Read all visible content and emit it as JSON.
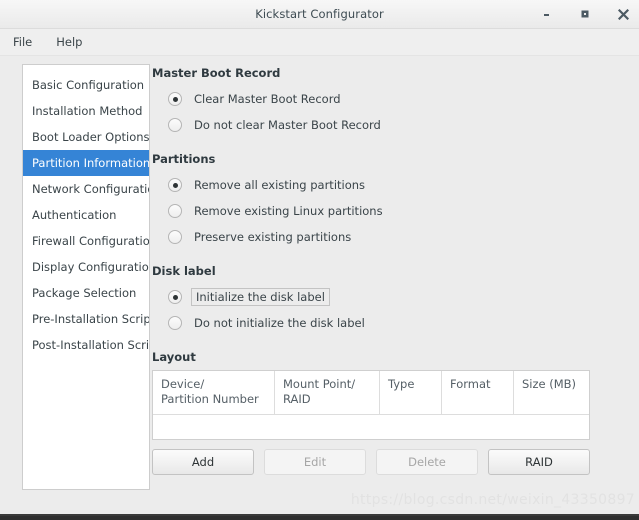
{
  "window": {
    "title": "Kickstart Configurator",
    "controls": [
      {
        "name": "minimize-button",
        "glyph": "minimize"
      },
      {
        "name": "maximize-button",
        "glyph": "maximize"
      },
      {
        "name": "close-button",
        "glyph": "close"
      }
    ]
  },
  "menubar": {
    "items": [
      {
        "label": "File"
      },
      {
        "label": "Help"
      }
    ]
  },
  "sidebar": {
    "items": [
      {
        "label": "Basic Configuration",
        "selected": false
      },
      {
        "label": "Installation Method",
        "selected": false
      },
      {
        "label": "Boot Loader Options",
        "selected": false
      },
      {
        "label": "Partition Information",
        "selected": true
      },
      {
        "label": "Network Configuration",
        "selected": false
      },
      {
        "label": "Authentication",
        "selected": false
      },
      {
        "label": "Firewall Configuration",
        "selected": false
      },
      {
        "label": "Display Configuration",
        "selected": false
      },
      {
        "label": "Package Selection",
        "selected": false
      },
      {
        "label": "Pre-Installation Script",
        "selected": false
      },
      {
        "label": "Post-Installation Script",
        "selected": false
      }
    ]
  },
  "main": {
    "groups": [
      {
        "title": "Master Boot Record",
        "options": [
          {
            "label": "Clear Master Boot Record",
            "checked": true,
            "focused": false
          },
          {
            "label": "Do not clear Master Boot Record",
            "checked": false,
            "focused": false
          }
        ]
      },
      {
        "title": "Partitions",
        "options": [
          {
            "label": "Remove all existing partitions",
            "checked": true,
            "focused": false
          },
          {
            "label": "Remove existing Linux partitions",
            "checked": false,
            "focused": false
          },
          {
            "label": "Preserve existing partitions",
            "checked": false,
            "focused": false
          }
        ]
      },
      {
        "title": "Disk label",
        "options": [
          {
            "label": "Initialize the disk label",
            "checked": true,
            "focused": true
          },
          {
            "label": "Do not initialize the disk label",
            "checked": false,
            "focused": false
          }
        ]
      }
    ],
    "layout": {
      "title": "Layout",
      "columns": [
        "Device/\nPartition Number",
        "Mount Point/\nRAID",
        "Type",
        "Format",
        "Size (MB)"
      ],
      "rows": [],
      "buttons": [
        {
          "label": "Add",
          "disabled": false
        },
        {
          "label": "Edit",
          "disabled": true
        },
        {
          "label": "Delete",
          "disabled": true
        },
        {
          "label": "RAID",
          "disabled": false
        }
      ]
    }
  },
  "watermark": {
    "text": "https://blog.csdn.net/weixin_43350897"
  },
  "colors": {
    "accent": "#3584d6",
    "window_bg": "#ececec",
    "panel_bg": "#ffffff",
    "text": "#3a4449"
  }
}
